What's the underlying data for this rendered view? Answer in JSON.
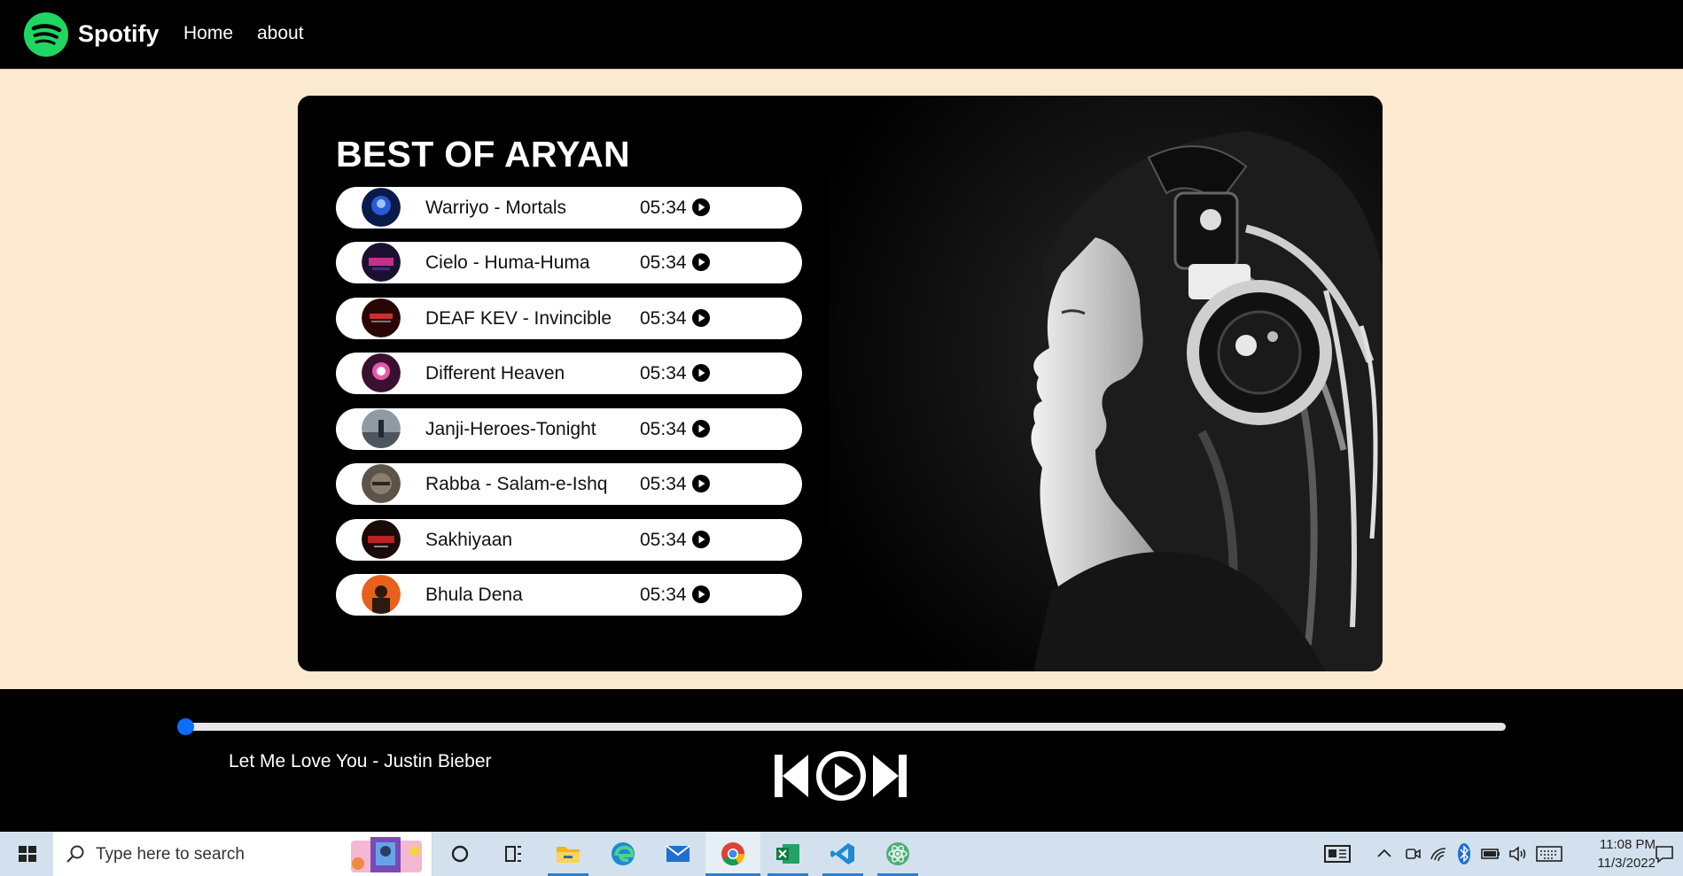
{
  "brand": {
    "name": "Spotify"
  },
  "nav": {
    "home": "Home",
    "about": "about"
  },
  "playlist": {
    "title": "BEST OF ARYAN",
    "songs": [
      {
        "name": "Warriyo - Mortals",
        "duration": "05:34"
      },
      {
        "name": "Cielo - Huma-Huma",
        "duration": "05:34"
      },
      {
        "name": "DEAF KEV - Invincible",
        "duration": "05:34"
      },
      {
        "name": "Different Heaven",
        "duration": "05:34"
      },
      {
        "name": "Janji-Heroes-Tonight",
        "duration": "05:34"
      },
      {
        "name": "Rabba - Salam-e-Ishq",
        "duration": "05:34"
      },
      {
        "name": "Sakhiyaan",
        "duration": "05:34"
      },
      {
        "name": "Bhula Dena",
        "duration": "05:34"
      }
    ]
  },
  "player": {
    "now_playing": "Let Me Love You - Justin Bieber",
    "progress": 0,
    "controls": [
      "previous-icon",
      "play-icon",
      "next-icon"
    ]
  },
  "taskbar": {
    "search_placeholder": "Type here to search",
    "time": "11:08 PM",
    "date": "11/3/2022",
    "apps": [
      "start-icon",
      "cortana-icon",
      "task-view-icon",
      "file-explorer-icon",
      "edge-icon",
      "mail-icon",
      "chrome-icon",
      "excel-icon",
      "vscode-icon",
      "atom-icon"
    ],
    "tray": [
      "news-icon",
      "chevron-up-icon",
      "meet-now-icon",
      "wifi-icon",
      "bluetooth-icon",
      "battery-icon",
      "volume-icon",
      "keyboard-icon",
      "notification-icon"
    ]
  },
  "colors": {
    "page_bg": "#fbe9d0",
    "spotify_green": "#1ed760",
    "progress_blue": "#0d6efd",
    "taskbar_bg": "#d3e1ee"
  }
}
